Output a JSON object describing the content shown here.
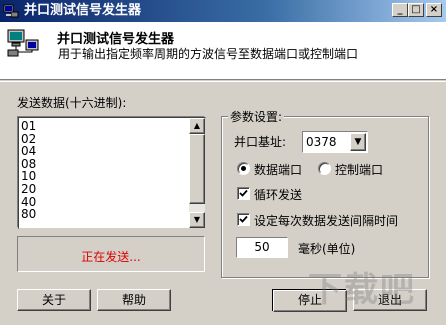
{
  "window": {
    "title": "并口测试信号发生器",
    "buttons": {
      "minimize": "_",
      "maximize": "□",
      "close": "×"
    }
  },
  "header": {
    "title": "并口测试信号发生器",
    "subtitle": "用于输出指定频率周期的方波信号至数据端口或控制端口"
  },
  "data_panel": {
    "label": "发送数据(十六进制):",
    "items": [
      "01",
      "02",
      "04",
      "08",
      "10",
      "20",
      "40",
      "80"
    ],
    "status": "正在发送..."
  },
  "params": {
    "title": "参数设置:",
    "port_base_label": "并口基址:",
    "port_base_value": "0378",
    "radio_data": "数据端口",
    "radio_control": "控制端口",
    "selected_port": "data",
    "loop_label": "循环发送",
    "loop_checked": true,
    "interval_label": "设定每次数据发送间隔时间",
    "interval_checked": true,
    "interval_value": "50",
    "interval_unit": "毫秒(单位)"
  },
  "buttons": {
    "about": "关于",
    "help": "帮助",
    "stop": "停止",
    "exit": "退出"
  },
  "watermark": "下载吧"
}
